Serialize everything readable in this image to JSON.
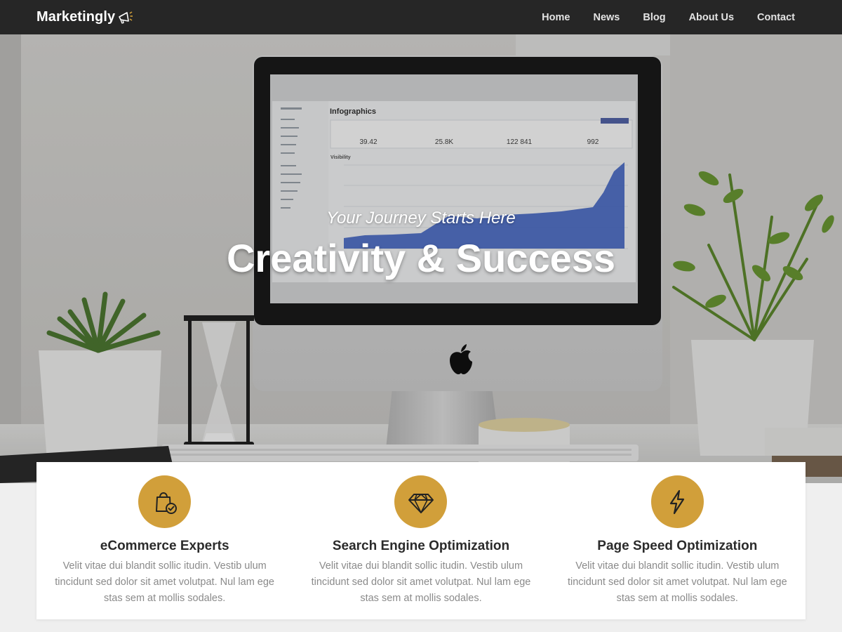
{
  "nav": {
    "brand": "Marketingly",
    "brand_icon": "megaphone-icon",
    "links": [
      "Home",
      "News",
      "Blog",
      "About Us",
      "Contact"
    ]
  },
  "hero": {
    "subtitle": "Your Journey Starts Here",
    "title": "Creativity & Success",
    "screen": {
      "heading": "Infographics",
      "stats": [
        "39.42",
        "25.8K",
        "122 841",
        "992"
      ],
      "section": "Visibility"
    }
  },
  "features": [
    {
      "icon": "shopping-bag-check-icon",
      "title": "eCommerce Experts",
      "desc": "Velit vitae dui blandit sollic itudin. Vestib ulum tincidunt sed dolor sit amet volutpat. Nul lam ege stas sem at mollis sodales."
    },
    {
      "icon": "diamond-icon",
      "title": "Search Engine Optimization",
      "desc": "Velit vitae dui blandit sollic itudin. Vestib ulum tincidunt sed dolor sit amet volutpat. Nul lam ege stas sem at mollis sodales."
    },
    {
      "icon": "lightning-icon",
      "title": "Page Speed Optimization",
      "desc": "Velit vitae dui blandit sollic itudin. Vestib ulum tincidunt sed dolor sit amet volutpat. Nul lam ege stas sem at mollis sodales."
    }
  ],
  "colors": {
    "nav_bg": "#262626",
    "accent": "#d19f3a",
    "feature_title": "#2b2b2b",
    "feature_text": "#8a8a8a"
  }
}
